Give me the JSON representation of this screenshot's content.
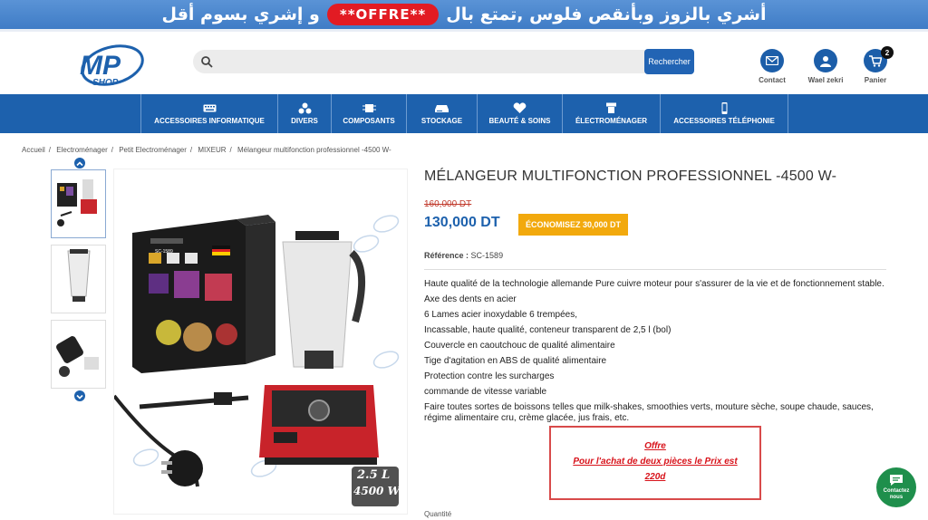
{
  "promo": {
    "text_left": "أشري بالزوز وبأنقص فلوس ,تمتع بال",
    "offre": "**OFFRE**",
    "text_right": "و إشري بسوم أقل"
  },
  "header": {
    "search_placeholder": "",
    "search_button": "Rechercher",
    "contact": "Contact",
    "user": "Wael zekri",
    "cart": "Panier",
    "cart_count": "2"
  },
  "nav": [
    {
      "label": "ACCESSOIRES INFORMATIQUE",
      "icon": "keyboard-icon"
    },
    {
      "label": "DIVERS",
      "icon": "shapes-icon"
    },
    {
      "label": "COMPOSANTS",
      "icon": "chip-icon"
    },
    {
      "label": "STOCKAGE",
      "icon": "disk-icon"
    },
    {
      "label": "BEAUTÉ & SOINS",
      "icon": "heart-icon"
    },
    {
      "label": "ÉLECTROMÉNAGER",
      "icon": "appliance-icon"
    },
    {
      "label": "ACCESSOIRES TÉLÉPHONIE",
      "icon": "phone-icon"
    }
  ],
  "breadcrumb": [
    "Accueil",
    "Electroménager",
    "Petit Electroménager",
    "MIXEUR",
    "Mélangeur multifonction professionnel -4500 W-"
  ],
  "product": {
    "title": "MÉLANGEUR MULTIFONCTION PROFESSIONNEL -4500 W-",
    "old_price": "160,000 DT",
    "price": "130,000 DT",
    "savings": "ÉCONOMISEZ 30,000 DT",
    "ref_label": "Référence :",
    "ref_value": "SC-1589",
    "description": [
      "Haute qualité de la technologie allemande Pure cuivre moteur pour s'assurer de la vie et de fonctionnement stable.",
      "Axe des dents en acier",
      "6 Lames acier inoxydable 6  trempées,",
      "Incassable, haute qualité, conteneur transparent de 2,5 l (bol)",
      "Couvercle en caoutchouc de qualité alimentaire",
      "Tige d'agitation en ABS de qualité alimentaire",
      "Protection contre les surcharges",
      "commande de vitesse variable",
      "Faire toutes sortes de boissons telles que milk-shakes, smoothies verts, mouture sèche, soupe chaude, sauces, régime alimentaire cru, crème glacée, jus frais, etc."
    ],
    "qty_label": "Quantité"
  },
  "image_text": {
    "box_model": "SC-1589",
    "capacity": "2.5 L",
    "power": "4500 W"
  },
  "offer": {
    "line1": "Offre",
    "line2": "Pour l'achat de deux pièces le Prix est",
    "line3": "220d"
  },
  "chat": {
    "label": "Contactez nous"
  },
  "colors": {
    "brand": "#1d61ad",
    "promo_red": "#e21b23",
    "save_badge": "#f2a90d",
    "chat_green": "#1f8f4c"
  }
}
